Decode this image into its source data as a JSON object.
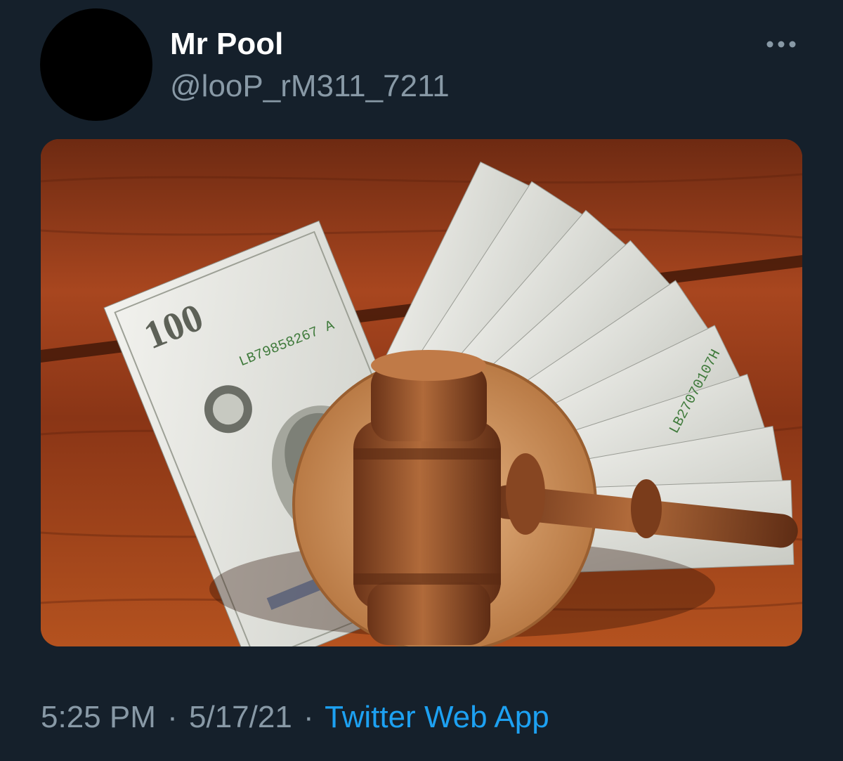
{
  "tweet": {
    "author": {
      "display_name": "Mr Pool",
      "handle": "@looP_rM311_7211"
    },
    "more_icon": "more-horizontal-icon",
    "media": {
      "banknote_denomination": "100",
      "serial_number": "LB79858267 A",
      "serial_number_reversed": "LB27070107H"
    },
    "time": "5:25 PM",
    "separator": "·",
    "date": "5/17/21",
    "source": "Twitter Web App"
  },
  "colors": {
    "background": "#15202b",
    "primary_text": "#ffffff",
    "secondary_text": "#8899a6",
    "link": "#1da1f2"
  }
}
